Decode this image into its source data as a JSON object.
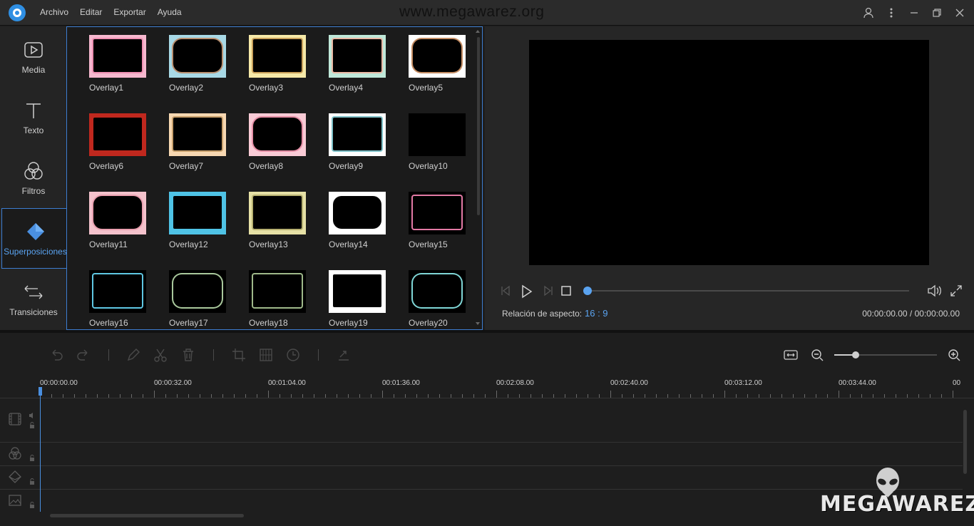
{
  "title_bar": {
    "menu": [
      "Archivo",
      "Editar",
      "Exportar",
      "Ayuda"
    ],
    "watermark_url": "www.megawarez.org"
  },
  "sidebar": {
    "items": [
      {
        "label": "Media",
        "icon": "media-icon"
      },
      {
        "label": "Texto",
        "icon": "text-icon"
      },
      {
        "label": "Filtros",
        "icon": "filters-icon"
      },
      {
        "label": "Superposiciones",
        "icon": "overlays-icon",
        "active": true
      },
      {
        "label": "Transiciones",
        "icon": "transitions-icon"
      }
    ]
  },
  "overlays": [
    {
      "label": "Overlay1",
      "bg": "#f6b8cf",
      "border": "#ef8fb2"
    },
    {
      "label": "Overlay2",
      "bg": "#a8d9e6",
      "border": "#b98f70"
    },
    {
      "label": "Overlay3",
      "bg": "#f6e9a8",
      "border": "#c9a05a"
    },
    {
      "label": "Overlay4",
      "bg": "#bfe8d9",
      "border": "#e9b7a4"
    },
    {
      "label": "Overlay5",
      "bg": "#ffffff",
      "border": "#c58d63"
    },
    {
      "label": "Overlay6",
      "bg": "#c0281e",
      "border": "#c0281e"
    },
    {
      "label": "Overlay7",
      "bg": "#f7d8b2",
      "border": "#c8a06c"
    },
    {
      "label": "Overlay8",
      "bg": "#f9cbd6",
      "border": "#e68fa6"
    },
    {
      "label": "Overlay9",
      "bg": "#ffffff",
      "border": "#7cc0c8"
    },
    {
      "label": "Overlay10",
      "bg": "#000000",
      "border": "#000000"
    },
    {
      "label": "Overlay11",
      "bg": "#f4c2cc",
      "border": "#eaa0b0"
    },
    {
      "label": "Overlay12",
      "bg": "#4fc3e6",
      "border": "#4fc3e6"
    },
    {
      "label": "Overlay13",
      "bg": "#e6e1a6",
      "border": "#b6b070"
    },
    {
      "label": "Overlay14",
      "bg": "#ffffff",
      "border": "#ffffff"
    },
    {
      "label": "Overlay15",
      "bg": "#000000",
      "border": "#e37aa5"
    },
    {
      "label": "Overlay16",
      "bg": "#000000",
      "border": "#5fc7e3"
    },
    {
      "label": "Overlay17",
      "bg": "#000000",
      "border": "#a9c89c"
    },
    {
      "label": "Overlay18",
      "bg": "#000000",
      "border": "#9fb98a"
    },
    {
      "label": "Overlay19",
      "bg": "#ffffff",
      "border": "#ffffff"
    },
    {
      "label": "Overlay20",
      "bg": "#000000",
      "border": "#7fd6d6"
    }
  ],
  "preview": {
    "aspect_label": "Relación de aspecto:",
    "aspect_value": "16 : 9",
    "timecode": "00:00:00.00 / 00:00:00.00",
    "progress": 0
  },
  "timeline": {
    "ruler": [
      "00:00:00.00",
      "00:00:32.00",
      "00:01:04.00",
      "00:01:36.00",
      "00:02:08.00",
      "00:02:40.00",
      "00:03:12.00",
      "00:03:44.00",
      "00"
    ],
    "zoom_level": 0.2
  },
  "watermark_brand": "MEGAWAREZ",
  "colors": {
    "accent": "#5aa3f0",
    "panel_border": "#3d7dd0"
  }
}
